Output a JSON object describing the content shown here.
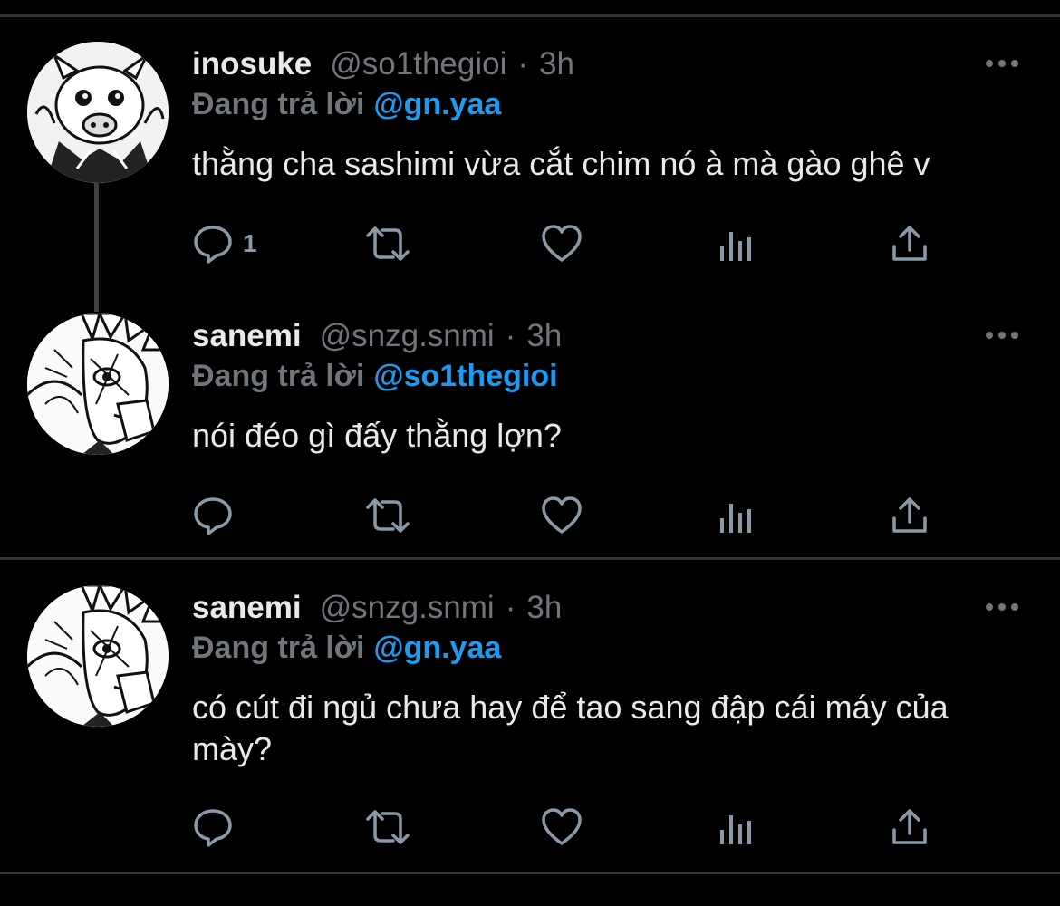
{
  "colors": {
    "background": "#000000",
    "divider": "#2f3336",
    "text": "#e7e9ea",
    "muted": "#71767b",
    "mention": "#1d9bf0",
    "icon": "#8b98a5"
  },
  "tweets": [
    {
      "name": "inosuke",
      "handle": "@so1thegioi",
      "separator": "·",
      "time": "3h",
      "reply_prefix": "Đang trả lời",
      "reply_to": "@gn.yaa",
      "text": "thằng cha sashimi vừa cắt chim nó à mà gào ghê v",
      "reply_count": "1",
      "avatar_icon": "avatar-inosuke"
    },
    {
      "name": "sanemi",
      "handle": "@snzg.snmi",
      "separator": "·",
      "time": "3h",
      "reply_prefix": "Đang trả lời",
      "reply_to": "@so1thegioi",
      "text": "nói đéo gì đấy thằng lợn?",
      "reply_count": "",
      "avatar_icon": "avatar-sanemi"
    },
    {
      "name": "sanemi",
      "handle": "@snzg.snmi",
      "separator": "·",
      "time": "3h",
      "reply_prefix": "Đang trả lời",
      "reply_to": "@gn.yaa",
      "text": "có cút đi ngủ chưa hay để tao sang đập cái máy của mày?",
      "reply_count": "",
      "avatar_icon": "avatar-sanemi"
    }
  ],
  "action_icons": [
    "reply-icon",
    "retweet-icon",
    "like-icon",
    "views-icon",
    "share-icon"
  ]
}
